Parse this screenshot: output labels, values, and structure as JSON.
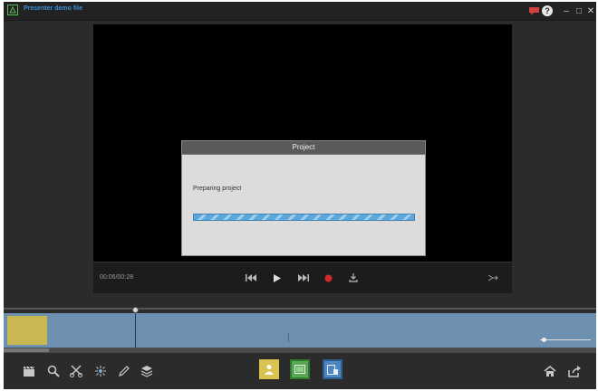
{
  "window": {
    "title": "Presenter demo file",
    "help_label": "?",
    "minimize_label": "–",
    "maximize_label": "□",
    "close_label": "✕"
  },
  "player": {
    "time": "00:06/00:28"
  },
  "dialog": {
    "title": "Project",
    "message": "Preparing project",
    "progress": 1.0
  },
  "colors": {
    "title_text": "#3d8fd6",
    "timeline": "#6d8fb0",
    "clip": "#c9b752",
    "record": "#d02a2a",
    "mode_presenter": "#d9c24f",
    "mode_screen": "#59a657",
    "mode_both": "#4f86bf"
  },
  "toolbar": {
    "left_tools": [
      "clapperboard-icon",
      "zoom-icon",
      "cut-icon",
      "spotlight-icon",
      "pen-icon",
      "layers-icon"
    ],
    "modes": [
      "presenter-mode",
      "screen-mode",
      "presenter-screen-mode"
    ],
    "right_tools": [
      "home-icon",
      "export-icon"
    ]
  }
}
